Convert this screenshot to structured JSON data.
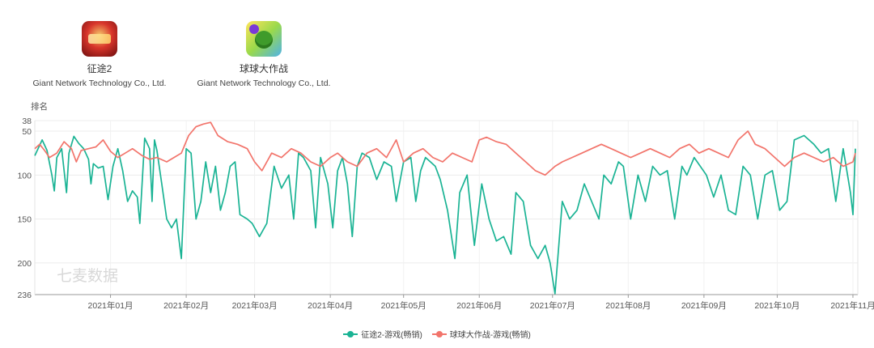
{
  "apps": [
    {
      "name": "征途2",
      "company": "Giant Network Technology Co., Ltd.",
      "icon": "zhengtu2-game-icon"
    },
    {
      "name": "球球大作战",
      "company": "Giant Network Technology Co., Ltd.",
      "icon": "qiuqiu-game-icon"
    }
  ],
  "watermark": "七麦数据",
  "chart_data": {
    "type": "line",
    "ylabel": "排名",
    "y_reversed": true,
    "ylim": [
      38,
      236
    ],
    "yticks": [
      38,
      50,
      100,
      150,
      200,
      236
    ],
    "xlim": [
      "2020-12-01",
      "2021-11-03"
    ],
    "xticks": [
      {
        "date": "2021-01-01",
        "label": "2021年01月"
      },
      {
        "date": "2021-02-01",
        "label": "2021年02月"
      },
      {
        "date": "2021-03-01",
        "label": "2021年03月"
      },
      {
        "date": "2021-04-01",
        "label": "2021年04月"
      },
      {
        "date": "2021-05-01",
        "label": "2021年05月"
      },
      {
        "date": "2021-06-01",
        "label": "2021年06月"
      },
      {
        "date": "2021-07-01",
        "label": "2021年07月"
      },
      {
        "date": "2021-08-01",
        "label": "2021年08月"
      },
      {
        "date": "2021-09-01",
        "label": "2021年09月"
      },
      {
        "date": "2021-10-01",
        "label": "2021年10月"
      },
      {
        "date": "2021-11-01",
        "label": "2021年11月"
      }
    ],
    "grid": true,
    "legend_position": "bottom",
    "series": [
      {
        "name": "征途2-游戏(畅销)",
        "color": "#1ab394",
        "points": [
          [
            "2020-12-01",
            78
          ],
          [
            "2020-12-04",
            60
          ],
          [
            "2020-12-06",
            72
          ],
          [
            "2020-12-08",
            100
          ],
          [
            "2020-12-09",
            118
          ],
          [
            "2020-12-10",
            80
          ],
          [
            "2020-12-12",
            70
          ],
          [
            "2020-12-14",
            120
          ],
          [
            "2020-12-15",
            75
          ],
          [
            "2020-12-17",
            56
          ],
          [
            "2020-12-19",
            64
          ],
          [
            "2020-12-21",
            70
          ],
          [
            "2020-12-23",
            82
          ],
          [
            "2020-12-24",
            110
          ],
          [
            "2020-12-25",
            87
          ],
          [
            "2020-12-27",
            92
          ],
          [
            "2020-12-29",
            90
          ],
          [
            "2020-12-31",
            128
          ],
          [
            "2021-01-02",
            90
          ],
          [
            "2021-01-04",
            70
          ],
          [
            "2021-01-06",
            95
          ],
          [
            "2021-01-08",
            130
          ],
          [
            "2021-01-10",
            118
          ],
          [
            "2021-01-12",
            125
          ],
          [
            "2021-01-13",
            155
          ],
          [
            "2021-01-15",
            58
          ],
          [
            "2021-01-17",
            70
          ],
          [
            "2021-01-18",
            130
          ],
          [
            "2021-01-19",
            60
          ],
          [
            "2021-01-20",
            72
          ],
          [
            "2021-01-22",
            110
          ],
          [
            "2021-01-24",
            150
          ],
          [
            "2021-01-26",
            160
          ],
          [
            "2021-01-28",
            150
          ],
          [
            "2021-01-30",
            195
          ],
          [
            "2021-02-01",
            70
          ],
          [
            "2021-02-03",
            75
          ],
          [
            "2021-02-05",
            150
          ],
          [
            "2021-02-07",
            130
          ],
          [
            "2021-02-09",
            85
          ],
          [
            "2021-02-11",
            120
          ],
          [
            "2021-02-13",
            90
          ],
          [
            "2021-02-15",
            140
          ],
          [
            "2021-02-17",
            120
          ],
          [
            "2021-02-19",
            90
          ],
          [
            "2021-02-21",
            85
          ],
          [
            "2021-02-23",
            145
          ],
          [
            "2021-02-26",
            150
          ],
          [
            "2021-02-28",
            155
          ],
          [
            "2021-03-03",
            170
          ],
          [
            "2021-03-06",
            155
          ],
          [
            "2021-03-09",
            90
          ],
          [
            "2021-03-12",
            115
          ],
          [
            "2021-03-15",
            100
          ],
          [
            "2021-03-17",
            150
          ],
          [
            "2021-03-19",
            75
          ],
          [
            "2021-03-21",
            80
          ],
          [
            "2021-03-24",
            95
          ],
          [
            "2021-03-26",
            160
          ],
          [
            "2021-03-28",
            80
          ],
          [
            "2021-03-31",
            110
          ],
          [
            "2021-04-02",
            160
          ],
          [
            "2021-04-04",
            95
          ],
          [
            "2021-04-06",
            80
          ],
          [
            "2021-04-08",
            110
          ],
          [
            "2021-04-10",
            170
          ],
          [
            "2021-04-12",
            90
          ],
          [
            "2021-04-14",
            75
          ],
          [
            "2021-04-17",
            80
          ],
          [
            "2021-04-20",
            105
          ],
          [
            "2021-04-23",
            85
          ],
          [
            "2021-04-26",
            90
          ],
          [
            "2021-04-28",
            130
          ],
          [
            "2021-05-01",
            85
          ],
          [
            "2021-05-04",
            80
          ],
          [
            "2021-05-06",
            130
          ],
          [
            "2021-05-08",
            95
          ],
          [
            "2021-05-10",
            80
          ],
          [
            "2021-05-12",
            85
          ],
          [
            "2021-05-14",
            90
          ],
          [
            "2021-05-16",
            105
          ],
          [
            "2021-05-19",
            140
          ],
          [
            "2021-05-22",
            195
          ],
          [
            "2021-05-24",
            120
          ],
          [
            "2021-05-27",
            100
          ],
          [
            "2021-05-30",
            180
          ],
          [
            "2021-06-02",
            110
          ],
          [
            "2021-06-05",
            150
          ],
          [
            "2021-06-08",
            175
          ],
          [
            "2021-06-11",
            170
          ],
          [
            "2021-06-14",
            190
          ],
          [
            "2021-06-16",
            120
          ],
          [
            "2021-06-19",
            130
          ],
          [
            "2021-06-22",
            180
          ],
          [
            "2021-06-25",
            195
          ],
          [
            "2021-06-28",
            180
          ],
          [
            "2021-06-30",
            200
          ],
          [
            "2021-07-02",
            235
          ],
          [
            "2021-07-05",
            130
          ],
          [
            "2021-07-08",
            150
          ],
          [
            "2021-07-11",
            140
          ],
          [
            "2021-07-14",
            110
          ],
          [
            "2021-07-17",
            130
          ],
          [
            "2021-07-20",
            150
          ],
          [
            "2021-07-22",
            100
          ],
          [
            "2021-07-25",
            110
          ],
          [
            "2021-07-28",
            85
          ],
          [
            "2021-07-30",
            90
          ],
          [
            "2021-08-02",
            150
          ],
          [
            "2021-08-05",
            100
          ],
          [
            "2021-08-08",
            130
          ],
          [
            "2021-08-11",
            90
          ],
          [
            "2021-08-14",
            100
          ],
          [
            "2021-08-17",
            95
          ],
          [
            "2021-08-20",
            150
          ],
          [
            "2021-08-23",
            90
          ],
          [
            "2021-08-25",
            100
          ],
          [
            "2021-08-28",
            80
          ],
          [
            "2021-09-02",
            100
          ],
          [
            "2021-09-05",
            125
          ],
          [
            "2021-09-08",
            100
          ],
          [
            "2021-09-11",
            140
          ],
          [
            "2021-09-14",
            145
          ],
          [
            "2021-09-17",
            90
          ],
          [
            "2021-09-20",
            100
          ],
          [
            "2021-09-23",
            150
          ],
          [
            "2021-09-26",
            100
          ],
          [
            "2021-09-29",
            95
          ],
          [
            "2021-10-02",
            140
          ],
          [
            "2021-10-05",
            130
          ],
          [
            "2021-10-08",
            60
          ],
          [
            "2021-10-12",
            55
          ],
          [
            "2021-10-16",
            65
          ],
          [
            "2021-10-19",
            75
          ],
          [
            "2021-10-22",
            70
          ],
          [
            "2021-10-25",
            130
          ],
          [
            "2021-10-28",
            70
          ],
          [
            "2021-10-31",
            120
          ],
          [
            "2021-11-01",
            145
          ],
          [
            "2021-11-02",
            70
          ]
        ]
      },
      {
        "name": "球球大作战-游戏(畅销)",
        "color": "#f2746b",
        "points": [
          [
            "2020-12-01",
            70
          ],
          [
            "2020-12-03",
            65
          ],
          [
            "2020-12-05",
            72
          ],
          [
            "2020-12-07",
            80
          ],
          [
            "2020-12-10",
            75
          ],
          [
            "2020-12-13",
            62
          ],
          [
            "2020-12-16",
            70
          ],
          [
            "2020-12-18",
            85
          ],
          [
            "2020-12-20",
            72
          ],
          [
            "2020-12-23",
            70
          ],
          [
            "2020-12-26",
            68
          ],
          [
            "2020-12-29",
            60
          ],
          [
            "2021-01-01",
            73
          ],
          [
            "2021-01-04",
            80
          ],
          [
            "2021-01-07",
            75
          ],
          [
            "2021-01-10",
            70
          ],
          [
            "2021-01-14",
            78
          ],
          [
            "2021-01-17",
            82
          ],
          [
            "2021-01-20",
            80
          ],
          [
            "2021-01-24",
            85
          ],
          [
            "2021-01-27",
            80
          ],
          [
            "2021-01-30",
            75
          ],
          [
            "2021-02-02",
            55
          ],
          [
            "2021-02-05",
            45
          ],
          [
            "2021-02-08",
            42
          ],
          [
            "2021-02-11",
            40
          ],
          [
            "2021-02-14",
            55
          ],
          [
            "2021-02-18",
            62
          ],
          [
            "2021-02-22",
            65
          ],
          [
            "2021-02-26",
            70
          ],
          [
            "2021-03-01",
            85
          ],
          [
            "2021-03-04",
            95
          ],
          [
            "2021-03-08",
            75
          ],
          [
            "2021-03-12",
            80
          ],
          [
            "2021-03-16",
            70
          ],
          [
            "2021-03-20",
            75
          ],
          [
            "2021-03-24",
            85
          ],
          [
            "2021-03-28",
            90
          ],
          [
            "2021-04-01",
            80
          ],
          [
            "2021-04-04",
            75
          ],
          [
            "2021-04-08",
            85
          ],
          [
            "2021-04-12",
            90
          ],
          [
            "2021-04-16",
            75
          ],
          [
            "2021-04-20",
            70
          ],
          [
            "2021-04-24",
            80
          ],
          [
            "2021-04-28",
            60
          ],
          [
            "2021-05-01",
            85
          ],
          [
            "2021-05-05",
            75
          ],
          [
            "2021-05-09",
            70
          ],
          [
            "2021-05-13",
            80
          ],
          [
            "2021-05-17",
            85
          ],
          [
            "2021-05-21",
            75
          ],
          [
            "2021-05-25",
            80
          ],
          [
            "2021-05-29",
            85
          ],
          [
            "2021-06-01",
            60
          ],
          [
            "2021-06-04",
            57
          ],
          [
            "2021-06-08",
            62
          ],
          [
            "2021-06-12",
            65
          ],
          [
            "2021-06-16",
            75
          ],
          [
            "2021-06-20",
            85
          ],
          [
            "2021-06-24",
            95
          ],
          [
            "2021-06-28",
            100
          ],
          [
            "2021-07-02",
            90
          ],
          [
            "2021-07-05",
            85
          ],
          [
            "2021-07-09",
            80
          ],
          [
            "2021-07-13",
            75
          ],
          [
            "2021-07-17",
            70
          ],
          [
            "2021-07-21",
            65
          ],
          [
            "2021-07-25",
            70
          ],
          [
            "2021-07-29",
            75
          ],
          [
            "2021-08-02",
            80
          ],
          [
            "2021-08-06",
            75
          ],
          [
            "2021-08-10",
            70
          ],
          [
            "2021-08-14",
            75
          ],
          [
            "2021-08-18",
            80
          ],
          [
            "2021-08-22",
            70
          ],
          [
            "2021-08-26",
            65
          ],
          [
            "2021-08-30",
            75
          ],
          [
            "2021-09-03",
            70
          ],
          [
            "2021-09-07",
            75
          ],
          [
            "2021-09-11",
            80
          ],
          [
            "2021-09-15",
            60
          ],
          [
            "2021-09-19",
            50
          ],
          [
            "2021-09-22",
            65
          ],
          [
            "2021-09-26",
            70
          ],
          [
            "2021-09-30",
            80
          ],
          [
            "2021-10-04",
            90
          ],
          [
            "2021-10-08",
            80
          ],
          [
            "2021-10-12",
            75
          ],
          [
            "2021-10-16",
            80
          ],
          [
            "2021-10-20",
            85
          ],
          [
            "2021-10-24",
            80
          ],
          [
            "2021-10-28",
            90
          ],
          [
            "2021-11-01",
            85
          ],
          [
            "2021-11-02",
            75
          ]
        ]
      }
    ]
  }
}
